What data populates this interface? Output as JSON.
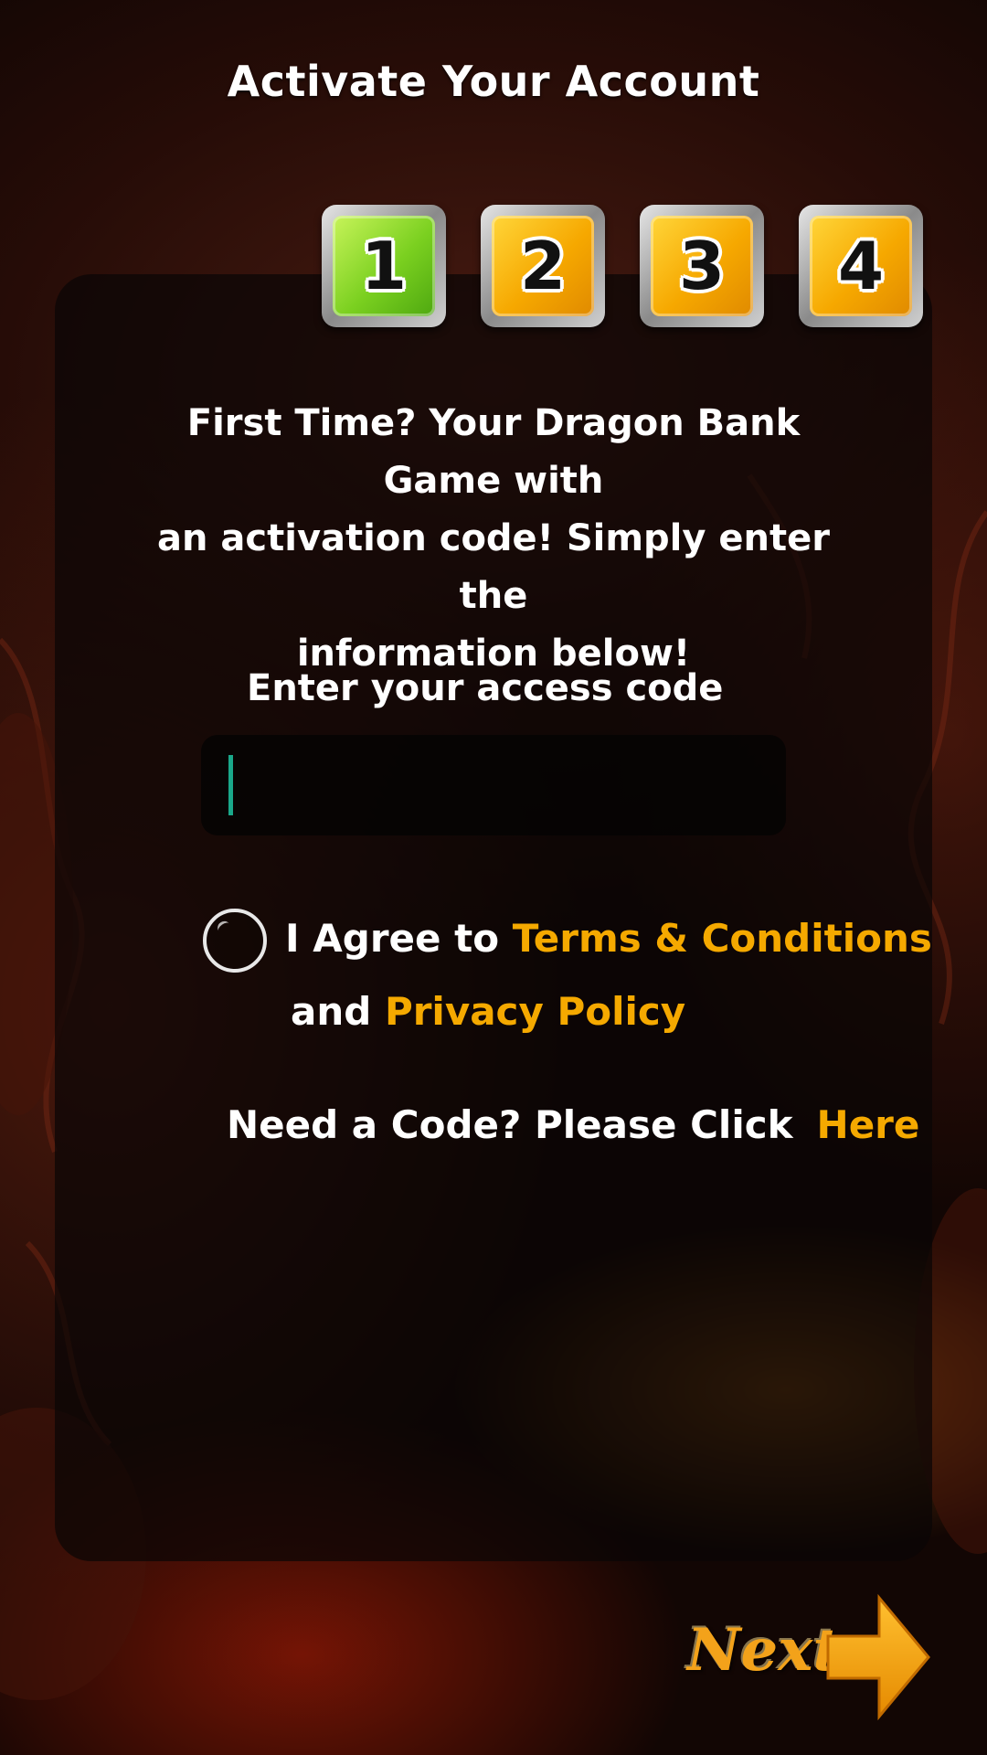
{
  "header": {
    "title": "Activate Your Account"
  },
  "steps": [
    {
      "number": "1",
      "state": "active"
    },
    {
      "number": "2",
      "state": "inactive"
    },
    {
      "number": "3",
      "state": "inactive"
    },
    {
      "number": "4",
      "state": "inactive"
    }
  ],
  "intro": {
    "line1": "First Time? Your Dragon Bank Game with",
    "line2": "an activation code! Simply enter the",
    "line3": "information below!"
  },
  "access_code": {
    "label": "Enter your access code",
    "value": "",
    "placeholder": ""
  },
  "agreement": {
    "prefix": "I Agree to ",
    "terms_link": "Terms & Conditions",
    "middle": "and ",
    "privacy_link": "Privacy Policy",
    "checked": false
  },
  "need_code": {
    "text": "Need a Code? Please Click",
    "link": "Here"
  },
  "next_button": {
    "label": "Next"
  },
  "colors": {
    "accent": "#f5a900",
    "active_step": "#7bd020",
    "inactive_step": "#f6a800",
    "caret": "#1aa88a"
  }
}
